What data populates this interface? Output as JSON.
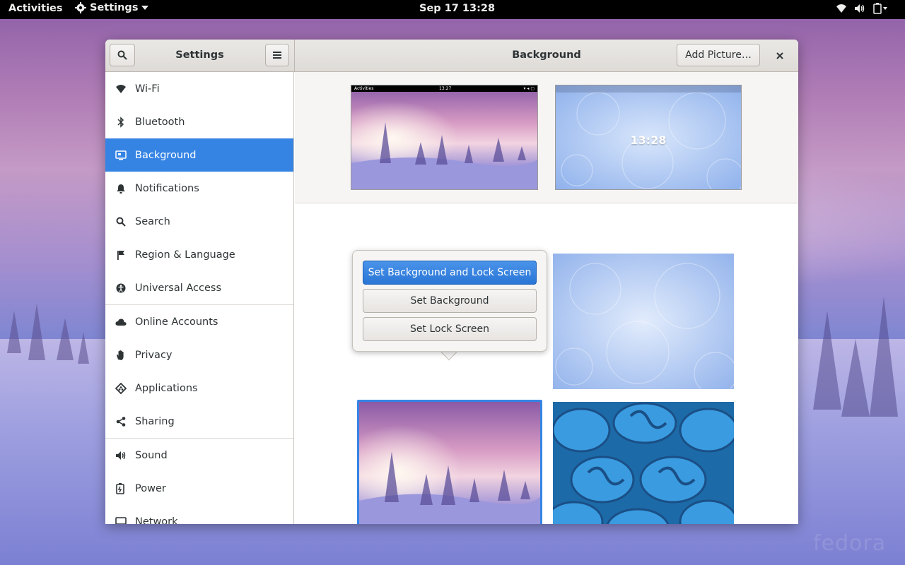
{
  "topbar": {
    "activities": "Activities",
    "app_menu": "Settings",
    "clock": "Sep 17  13:28",
    "status_icons": [
      "wifi-icon",
      "volume-icon",
      "battery-icon"
    ]
  },
  "desktop": {
    "watermark": "fedora"
  },
  "window": {
    "sidebar_title": "Settings",
    "content_title": "Background",
    "add_picture_label": "Add Picture…",
    "sidebar_items": [
      {
        "label": "Wi-Fi",
        "icon": "wifi-icon"
      },
      {
        "label": "Bluetooth",
        "icon": "bluetooth-icon"
      },
      {
        "label": "Background",
        "icon": "background-icon",
        "active": true
      },
      {
        "label": "Notifications",
        "icon": "bell-icon"
      },
      {
        "label": "Search",
        "icon": "search-icon"
      },
      {
        "label": "Region & Language",
        "icon": "flag-icon"
      },
      {
        "label": "Universal Access",
        "icon": "accessibility-icon"
      },
      {
        "label": "Online Accounts",
        "icon": "cloud-icon"
      },
      {
        "label": "Privacy",
        "icon": "hand-icon"
      },
      {
        "label": "Applications",
        "icon": "applications-icon"
      },
      {
        "label": "Sharing",
        "icon": "share-icon"
      },
      {
        "label": "Sound",
        "icon": "speaker-icon"
      },
      {
        "label": "Power",
        "icon": "power-icon"
      },
      {
        "label": "Network",
        "icon": "network-icon"
      }
    ]
  },
  "preview": {
    "mini_bar": {
      "activities": "Activities",
      "clock": "13:27"
    },
    "lock_time": "13:28"
  },
  "popover": {
    "set_both": "Set Background and Lock Screen",
    "set_background": "Set Background",
    "set_lock": "Set Lock Screen"
  },
  "colors": {
    "accent": "#3584e4",
    "headerbar": "#e3e0dd",
    "topbar": "#000000"
  }
}
